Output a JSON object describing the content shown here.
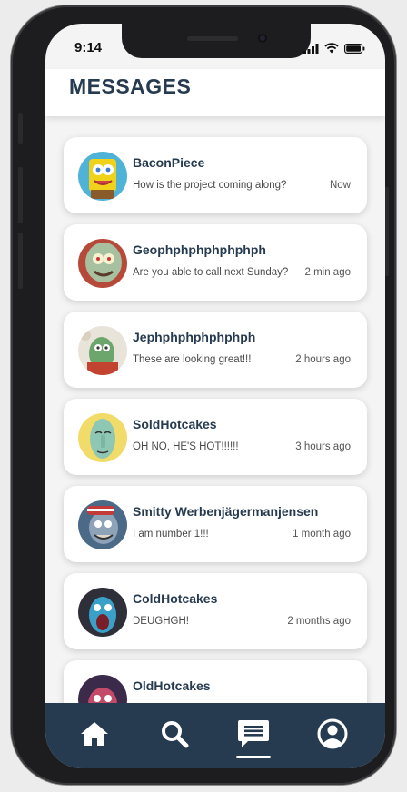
{
  "status": {
    "time": "9:14"
  },
  "header": {
    "title": "MESSAGES"
  },
  "conversations": [
    {
      "name": "BaconPiece",
      "preview": "How is the project coming along?",
      "time": "Now",
      "avatar_color": "#f1d21a"
    },
    {
      "name": "Geophphphphphphph",
      "preview": "Are you able to call next Sunday?",
      "time": "2 min ago",
      "avatar_color": "#a6b8a0"
    },
    {
      "name": "Jephphphphphphph",
      "preview": "These are looking great!!!",
      "time": "2 hours ago",
      "avatar_color": "#6ca66c"
    },
    {
      "name": "SoldHotcakes",
      "preview": "OH NO, HE'S HOT!!!!!!",
      "time": "3 hours ago",
      "avatar_color": "#8ec7b4"
    },
    {
      "name": "Smitty Werbenjägermanjensen",
      "preview": "I am number 1!!!",
      "time": "1 month ago",
      "avatar_color": "#5d7aa0"
    },
    {
      "name": "ColdHotcakes",
      "preview": "DEUGHGH!",
      "time": "2 months ago",
      "avatar_color": "#3aa0c8"
    },
    {
      "name": "OldHotcakes",
      "preview": "",
      "time": "",
      "avatar_color": "#3b2a4a"
    }
  ],
  "tabs": [
    {
      "name": "home",
      "icon": "home-icon"
    },
    {
      "name": "search",
      "icon": "search-icon"
    },
    {
      "name": "messages",
      "icon": "chat-icon",
      "active": true
    },
    {
      "name": "profile",
      "icon": "user-icon"
    }
  ],
  "colors": {
    "primary": "#263b50",
    "background": "#f4f4f4",
    "card": "#ffffff"
  }
}
